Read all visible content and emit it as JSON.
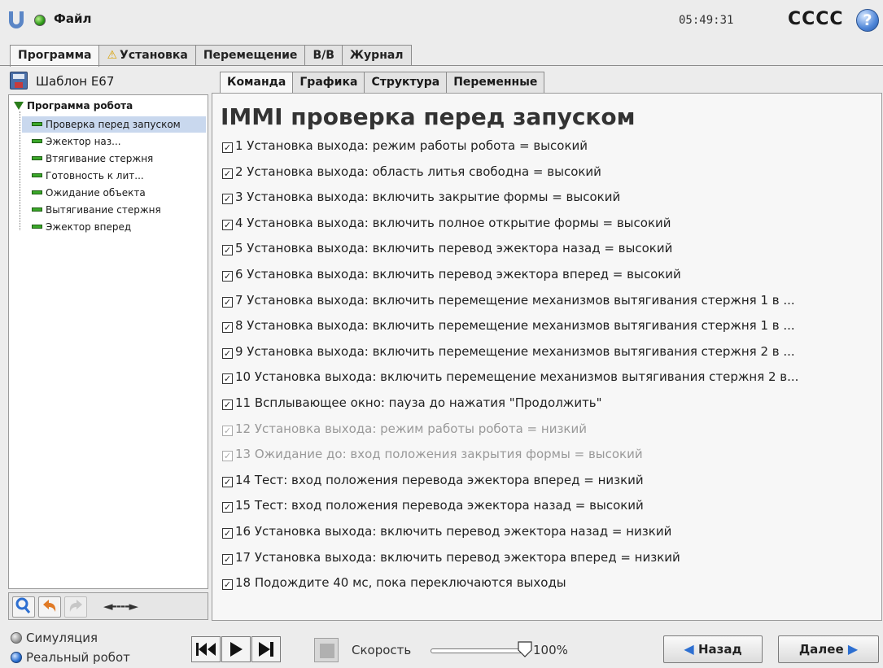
{
  "topbar": {
    "file_menu": "Файл",
    "clock": "05:49:31",
    "robot_name": "CCCC",
    "help": "?"
  },
  "top_tabs": [
    {
      "label": "Программа",
      "active": true
    },
    {
      "label": "Установка",
      "warning": true
    },
    {
      "label": "Перемещение"
    },
    {
      "label": "В/В"
    },
    {
      "label": "Журнал"
    }
  ],
  "program": {
    "name": "Шаблон E67"
  },
  "tree": {
    "root": "Программа робота",
    "items": [
      {
        "label": "Проверка перед запуском",
        "selected": true
      },
      {
        "label": "Эжектор наз..."
      },
      {
        "label": "Втягивание стержня"
      },
      {
        "label": "Готовность к лит..."
      },
      {
        "label": "Ожидание объекта"
      },
      {
        "label": "Вытягивание стержня"
      },
      {
        "label": "Эжектор вперед"
      }
    ]
  },
  "left_toolbar": {
    "nav_arrows": "◄----►"
  },
  "sub_tabs": [
    {
      "label": "Команда",
      "active": true
    },
    {
      "label": "Графика"
    },
    {
      "label": "Структура"
    },
    {
      "label": "Переменные"
    }
  ],
  "node_title": "IMMI проверка перед запуском",
  "commands": [
    {
      "text": "1 Установка выхода: режим работы робота = высокий",
      "enabled": true
    },
    {
      "text": "2 Установка выхода: область литья свободна = высокий",
      "enabled": true
    },
    {
      "text": "3 Установка выхода: включить закрытие формы = высокий",
      "enabled": true
    },
    {
      "text": "4 Установка выхода: включить полное открытие формы = высокий",
      "enabled": true
    },
    {
      "text": "5 Установка выхода: включить перевод эжектора назад = высокий",
      "enabled": true
    },
    {
      "text": "6 Установка выхода: включить перевод эжектора вперед = высокий",
      "enabled": true
    },
    {
      "text": "7 Установка выхода: включить перемещение механизмов вытягивания стержня 1 в ...",
      "enabled": true
    },
    {
      "text": "8 Установка выхода: включить перемещение механизмов вытягивания стержня 1 в ...",
      "enabled": true
    },
    {
      "text": "9 Установка выхода: включить перемещение механизмов вытягивания стержня 2 в ...",
      "enabled": true
    },
    {
      "text": "10 Установка выхода: включить перемещение механизмов вытягивания стержня 2 в...",
      "enabled": true
    },
    {
      "text": "11 Всплывающее окно: пауза до нажатия \"Продолжить\"",
      "enabled": true
    },
    {
      "text": "12 Установка выхода: режим работы робота = низкий",
      "enabled": false
    },
    {
      "text": "13 Ожидание до: вход положения закрытия формы = высокий",
      "enabled": false
    },
    {
      "text": "14 Тест: вход положения перевода эжектора вперед = низкий",
      "enabled": true
    },
    {
      "text": "15 Тест: вход положения перевода эжектора назад = высокий",
      "enabled": true
    },
    {
      "text": "16 Установка выхода: включить перевод эжектора назад = низкий",
      "enabled": true
    },
    {
      "text": "17 Установка выхода: включить перевод эжектора вперед = низкий",
      "enabled": true
    },
    {
      "text": "18 Подождите 40 мс, пока переключаются выходы",
      "enabled": true
    }
  ],
  "bottom": {
    "simulation": "Симуляция",
    "real_robot": "Реальный робот",
    "speed_label": "Скорость",
    "speed_value": "100%",
    "speed_fraction": 1.0,
    "back": "Назад",
    "next": "Далее"
  }
}
